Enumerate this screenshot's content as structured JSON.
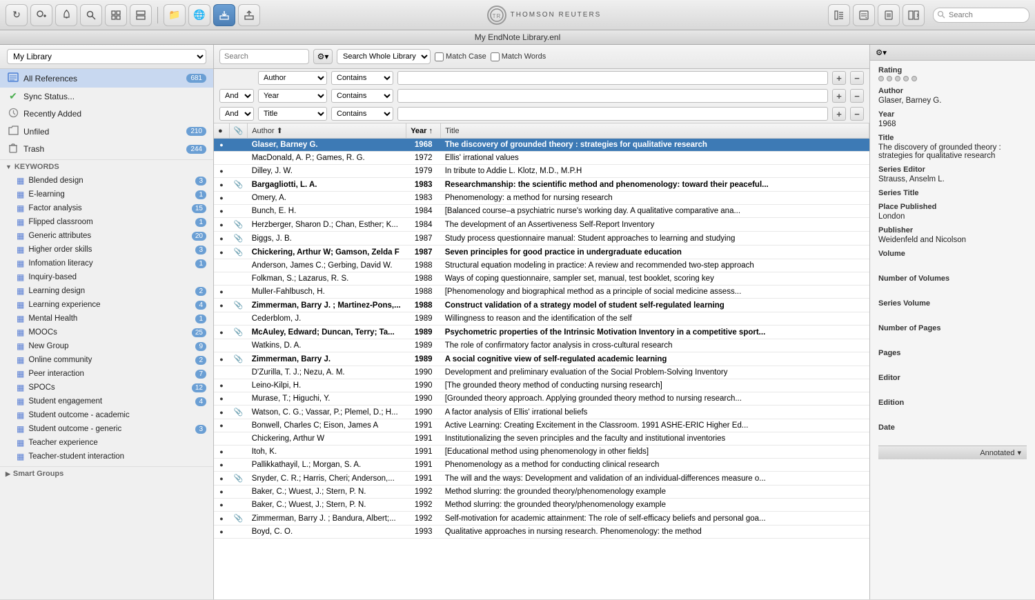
{
  "window": {
    "title": "My EndNote Library.enl"
  },
  "toolbar": {
    "buttons": [
      {
        "id": "sync",
        "icon": "↻",
        "label": "sync"
      },
      {
        "id": "add-contact",
        "icon": "👤+",
        "label": "add"
      },
      {
        "id": "bell",
        "icon": "🔔",
        "label": "notification"
      },
      {
        "id": "search",
        "icon": "🔍",
        "label": "search"
      },
      {
        "id": "groups",
        "icon": "⊞",
        "label": "groups"
      },
      {
        "id": "groups2",
        "icon": "⊟",
        "label": "groups2"
      },
      {
        "id": "folder",
        "icon": "📁",
        "label": "folder"
      },
      {
        "id": "globe",
        "icon": "🌐",
        "label": "globe"
      },
      {
        "id": "import",
        "icon": "📥",
        "label": "import",
        "active": true
      },
      {
        "id": "export",
        "icon": "📤",
        "label": "export"
      }
    ],
    "logo_text": "THOMSON REUTERS",
    "right_buttons": [
      {
        "id": "ref-view",
        "icon": "▤",
        "label": "reference-view"
      },
      {
        "id": "chat",
        "icon": "💬",
        "label": "chat"
      },
      {
        "id": "preview",
        "icon": "📄",
        "label": "preview"
      },
      {
        "id": "layout",
        "icon": "⊞▾",
        "label": "layout"
      }
    ],
    "search_placeholder": "Search"
  },
  "sidebar": {
    "library_dropdown": "My Library",
    "library_items": [
      {
        "id": "all-refs",
        "icon": "📋",
        "label": "All References",
        "badge": "681",
        "active": true,
        "icon_color": "blue"
      },
      {
        "id": "sync-status",
        "icon": "✔",
        "label": "Sync Status...",
        "badge": "",
        "icon_color": "green"
      },
      {
        "id": "recently-added",
        "icon": "🕐",
        "label": "Recently Added",
        "badge": ""
      },
      {
        "id": "unfiled",
        "icon": "📄",
        "label": "Unfiled",
        "badge": "210"
      },
      {
        "id": "trash",
        "icon": "🗑",
        "label": "Trash",
        "badge": "244"
      }
    ],
    "keywords_section": "KEYWORDS",
    "keyword_items": [
      {
        "label": "Blended design",
        "badge": "3"
      },
      {
        "label": "E-learning",
        "badge": "1"
      },
      {
        "label": "Factor analysis",
        "badge": "15"
      },
      {
        "label": "Flipped classroom",
        "badge": "1"
      },
      {
        "label": "Generic attributes",
        "badge": "20"
      },
      {
        "label": "Higher order skills",
        "badge": "3"
      },
      {
        "label": "Infomation literacy",
        "badge": "1"
      },
      {
        "label": "Inquiry-based",
        "badge": ""
      },
      {
        "label": "Learning design",
        "badge": "2"
      },
      {
        "label": "Learning experience",
        "badge": "4"
      },
      {
        "label": "Mental Health",
        "badge": "1"
      },
      {
        "label": "MOOCs",
        "badge": "25"
      },
      {
        "label": "New Group",
        "badge": "9"
      },
      {
        "label": "Online community",
        "badge": "2"
      },
      {
        "label": "Peer interaction",
        "badge": "7"
      },
      {
        "label": "SPOCs",
        "badge": "12"
      },
      {
        "label": "Student engagement",
        "badge": "4"
      },
      {
        "label": "Student outcome - academic",
        "badge": ""
      },
      {
        "label": "Student outcome - generic",
        "badge": "3"
      },
      {
        "label": "Teacher experience",
        "badge": ""
      },
      {
        "label": "Teacher-student interaction",
        "badge": ""
      }
    ],
    "smart_groups_section": "Smart Groups"
  },
  "search_bar": {
    "search_placeholder": "Search",
    "whole_library_label": "Search Whole Library",
    "match_case_label": "Match Case",
    "match_words_label": "Match Words"
  },
  "filter_rows": [
    {
      "conjunction": "",
      "field": "Author",
      "condition": "Contains",
      "value": ""
    },
    {
      "conjunction": "And",
      "field": "Year",
      "condition": "Contains",
      "value": ""
    },
    {
      "conjunction": "And",
      "field": "Title",
      "condition": "Contains",
      "value": ""
    }
  ],
  "table": {
    "columns": [
      "",
      "📎",
      "Author",
      "Year",
      "Title"
    ],
    "sort_col": "Year",
    "sort_dir": "asc",
    "rows": [
      {
        "dot": true,
        "clip": false,
        "author": "Glaser, Barney G.",
        "year": "1968",
        "title": "The discovery of grounded theory : strategies for qualitative research",
        "selected": true,
        "bold": true
      },
      {
        "dot": false,
        "clip": false,
        "author": "MacDonald, A. P.; Games, R. G.",
        "year": "1972",
        "title": "Ellis' irrational values",
        "selected": false,
        "bold": false
      },
      {
        "dot": true,
        "clip": false,
        "author": "Dilley, J. W.",
        "year": "1979",
        "title": "In tribute to Addie L. Klotz, M.D., M.P.H",
        "selected": false,
        "bold": false
      },
      {
        "dot": true,
        "clip": true,
        "author": "Bargagliotti, L. A.",
        "year": "1983",
        "title": "Researchmanship: the scientific method and phenomenology: toward their peaceful...",
        "selected": false,
        "bold": true
      },
      {
        "dot": true,
        "clip": false,
        "author": "Omery, A.",
        "year": "1983",
        "title": "Phenomenology: a method for nursing research",
        "selected": false,
        "bold": false
      },
      {
        "dot": true,
        "clip": false,
        "author": "Bunch, E. H.",
        "year": "1984",
        "title": "[Balanced course–a psychiatric nurse's working day. A qualitative comparative ana...",
        "selected": false,
        "bold": false
      },
      {
        "dot": true,
        "clip": true,
        "author": "Herzberger, Sharon D.; Chan, Esther; K...",
        "year": "1984",
        "title": "The development of an Assertiveness Self-Report Inventory",
        "selected": false,
        "bold": false
      },
      {
        "dot": true,
        "clip": true,
        "author": "Biggs, J. B.",
        "year": "1987",
        "title": "Study process questionnaire manual: Student approaches to learning and studying",
        "selected": false,
        "bold": false
      },
      {
        "dot": true,
        "clip": true,
        "author": "Chickering, Arthur W; Gamson, Zelda F",
        "year": "1987",
        "title": "Seven principles for good practice in undergraduate education",
        "selected": false,
        "bold": true
      },
      {
        "dot": false,
        "clip": false,
        "author": "Anderson, James C.; Gerbing, David W.",
        "year": "1988",
        "title": "Structural equation modeling in practice: A review and recommended two-step approach",
        "selected": false,
        "bold": false
      },
      {
        "dot": false,
        "clip": false,
        "author": "Folkman, S.; Lazarus, R. S.",
        "year": "1988",
        "title": "Ways of coping questionnaire, sampler set, manual, test booklet, scoring key",
        "selected": false,
        "bold": false
      },
      {
        "dot": true,
        "clip": false,
        "author": "Muller-Fahlbusch, H.",
        "year": "1988",
        "title": "[Phenomenology and biographical method as a principle of social medicine assess...",
        "selected": false,
        "bold": false
      },
      {
        "dot": true,
        "clip": true,
        "author": "Zimmerman, Barry J. ; Martinez-Pons,...",
        "year": "1988",
        "title": "Construct validation of a strategy model of student self-regulated learning",
        "selected": false,
        "bold": true
      },
      {
        "dot": false,
        "clip": false,
        "author": "Cederblom, J.",
        "year": "1989",
        "title": "Willingness to reason and the identification of the self",
        "selected": false,
        "bold": false
      },
      {
        "dot": true,
        "clip": true,
        "author": "McAuley, Edward; Duncan, Terry; Ta...",
        "year": "1989",
        "title": "Psychometric properties of the Intrinsic Motivation Inventory in a competitive sport...",
        "selected": false,
        "bold": true
      },
      {
        "dot": false,
        "clip": false,
        "author": "Watkins, D. A.",
        "year": "1989",
        "title": "The role of confirmatory factor analysis in cross-cultural research",
        "selected": false,
        "bold": false
      },
      {
        "dot": true,
        "clip": true,
        "author": "Zimmerman, Barry J.",
        "year": "1989",
        "title": "A social cognitive view of self-regulated academic learning",
        "selected": false,
        "bold": true
      },
      {
        "dot": false,
        "clip": false,
        "author": "D'Zurilla, T. J.; Nezu, A. M.",
        "year": "1990",
        "title": "Development and preliminary evaluation of the Social Problem-Solving Inventory",
        "selected": false,
        "bold": false
      },
      {
        "dot": true,
        "clip": false,
        "author": "Leino-Kilpi, H.",
        "year": "1990",
        "title": "[The grounded theory method of conducting nursing research]",
        "selected": false,
        "bold": false
      },
      {
        "dot": true,
        "clip": false,
        "author": "Murase, T.; Higuchi, Y.",
        "year": "1990",
        "title": "[Grounded theory approach. Applying grounded theory method to nursing research...",
        "selected": false,
        "bold": false
      },
      {
        "dot": true,
        "clip": true,
        "author": "Watson, C. G.; Vassar, P.; Plemel, D.; H...",
        "year": "1990",
        "title": "A factor analysis of Ellis' irrational beliefs",
        "selected": false,
        "bold": false
      },
      {
        "dot": true,
        "clip": false,
        "author": "Bonwell, Charles C; Eison, James A",
        "year": "1991",
        "title": "Active Learning: Creating Excitement in the Classroom. 1991 ASHE-ERIC Higher Ed...",
        "selected": false,
        "bold": false
      },
      {
        "dot": false,
        "clip": false,
        "author": "Chickering, Arthur W",
        "year": "1991",
        "title": "Institutionalizing the seven principles and the faculty and institutional inventories",
        "selected": false,
        "bold": false
      },
      {
        "dot": true,
        "clip": false,
        "author": "Itoh, K.",
        "year": "1991",
        "title": "[Educational method using phenomenology in other fields]",
        "selected": false,
        "bold": false
      },
      {
        "dot": true,
        "clip": false,
        "author": "Pallikkathayil, L.; Morgan, S. A.",
        "year": "1991",
        "title": "Phenomenology as a method for conducting clinical research",
        "selected": false,
        "bold": false
      },
      {
        "dot": true,
        "clip": true,
        "author": "Snyder, C. R.; Harris, Cheri; Anderson,...",
        "year": "1991",
        "title": "The will and the ways: Development and validation of an individual-differences measure o...",
        "selected": false,
        "bold": false
      },
      {
        "dot": true,
        "clip": false,
        "author": "Baker, C.; Wuest, J.; Stern, P. N.",
        "year": "1992",
        "title": "Method slurring: the grounded theory/phenomenology example",
        "selected": false,
        "bold": false
      },
      {
        "dot": true,
        "clip": false,
        "author": "Baker, C.; Wuest, J.; Stern, P. N.",
        "year": "1992",
        "title": "Method slurring: the grounded theory/phenomenology example",
        "selected": false,
        "bold": false
      },
      {
        "dot": true,
        "clip": true,
        "author": "Zimmerman, Barry J. ; Bandura, Albert;...",
        "year": "1992",
        "title": "Self-motivation for academic attainment: The role of self-efficacy beliefs and personal goa...",
        "selected": false,
        "bold": false
      },
      {
        "dot": true,
        "clip": false,
        "author": "Boyd, C. O.",
        "year": "1993",
        "title": "Qualitative approaches in nursing research. Phenomenology: the method",
        "selected": false,
        "bold": false
      }
    ]
  },
  "detail_panel": {
    "rating_label": "Rating",
    "rating_dots": [
      0,
      0,
      0,
      0,
      0
    ],
    "author_label": "Author",
    "author_value": "Glaser, Barney G.",
    "year_label": "Year",
    "year_value": "1968",
    "title_label": "Title",
    "title_value": "The discovery of grounded theory : strategies for qualitative research",
    "series_editor_label": "Series Editor",
    "series_editor_value": "Strauss, Anselm L.",
    "series_title_label": "Series Title",
    "series_title_value": "",
    "place_published_label": "Place Published",
    "place_published_value": "London",
    "publisher_label": "Publisher",
    "publisher_value": "Weidenfeld and Nicolson",
    "volume_label": "Volume",
    "volume_value": "",
    "number_of_volumes_label": "Number of Volumes",
    "number_of_volumes_value": "",
    "series_volume_label": "Series Volume",
    "series_volume_value": "",
    "number_of_pages_label": "Number of Pages",
    "number_of_pages_value": "",
    "pages_label": "Pages",
    "pages_value": "",
    "editor_label": "Editor",
    "editor_value": "",
    "edition_label": "Edition",
    "edition_value": "",
    "date_label": "Date",
    "date_value": "",
    "annotated_label": "Annotated"
  }
}
